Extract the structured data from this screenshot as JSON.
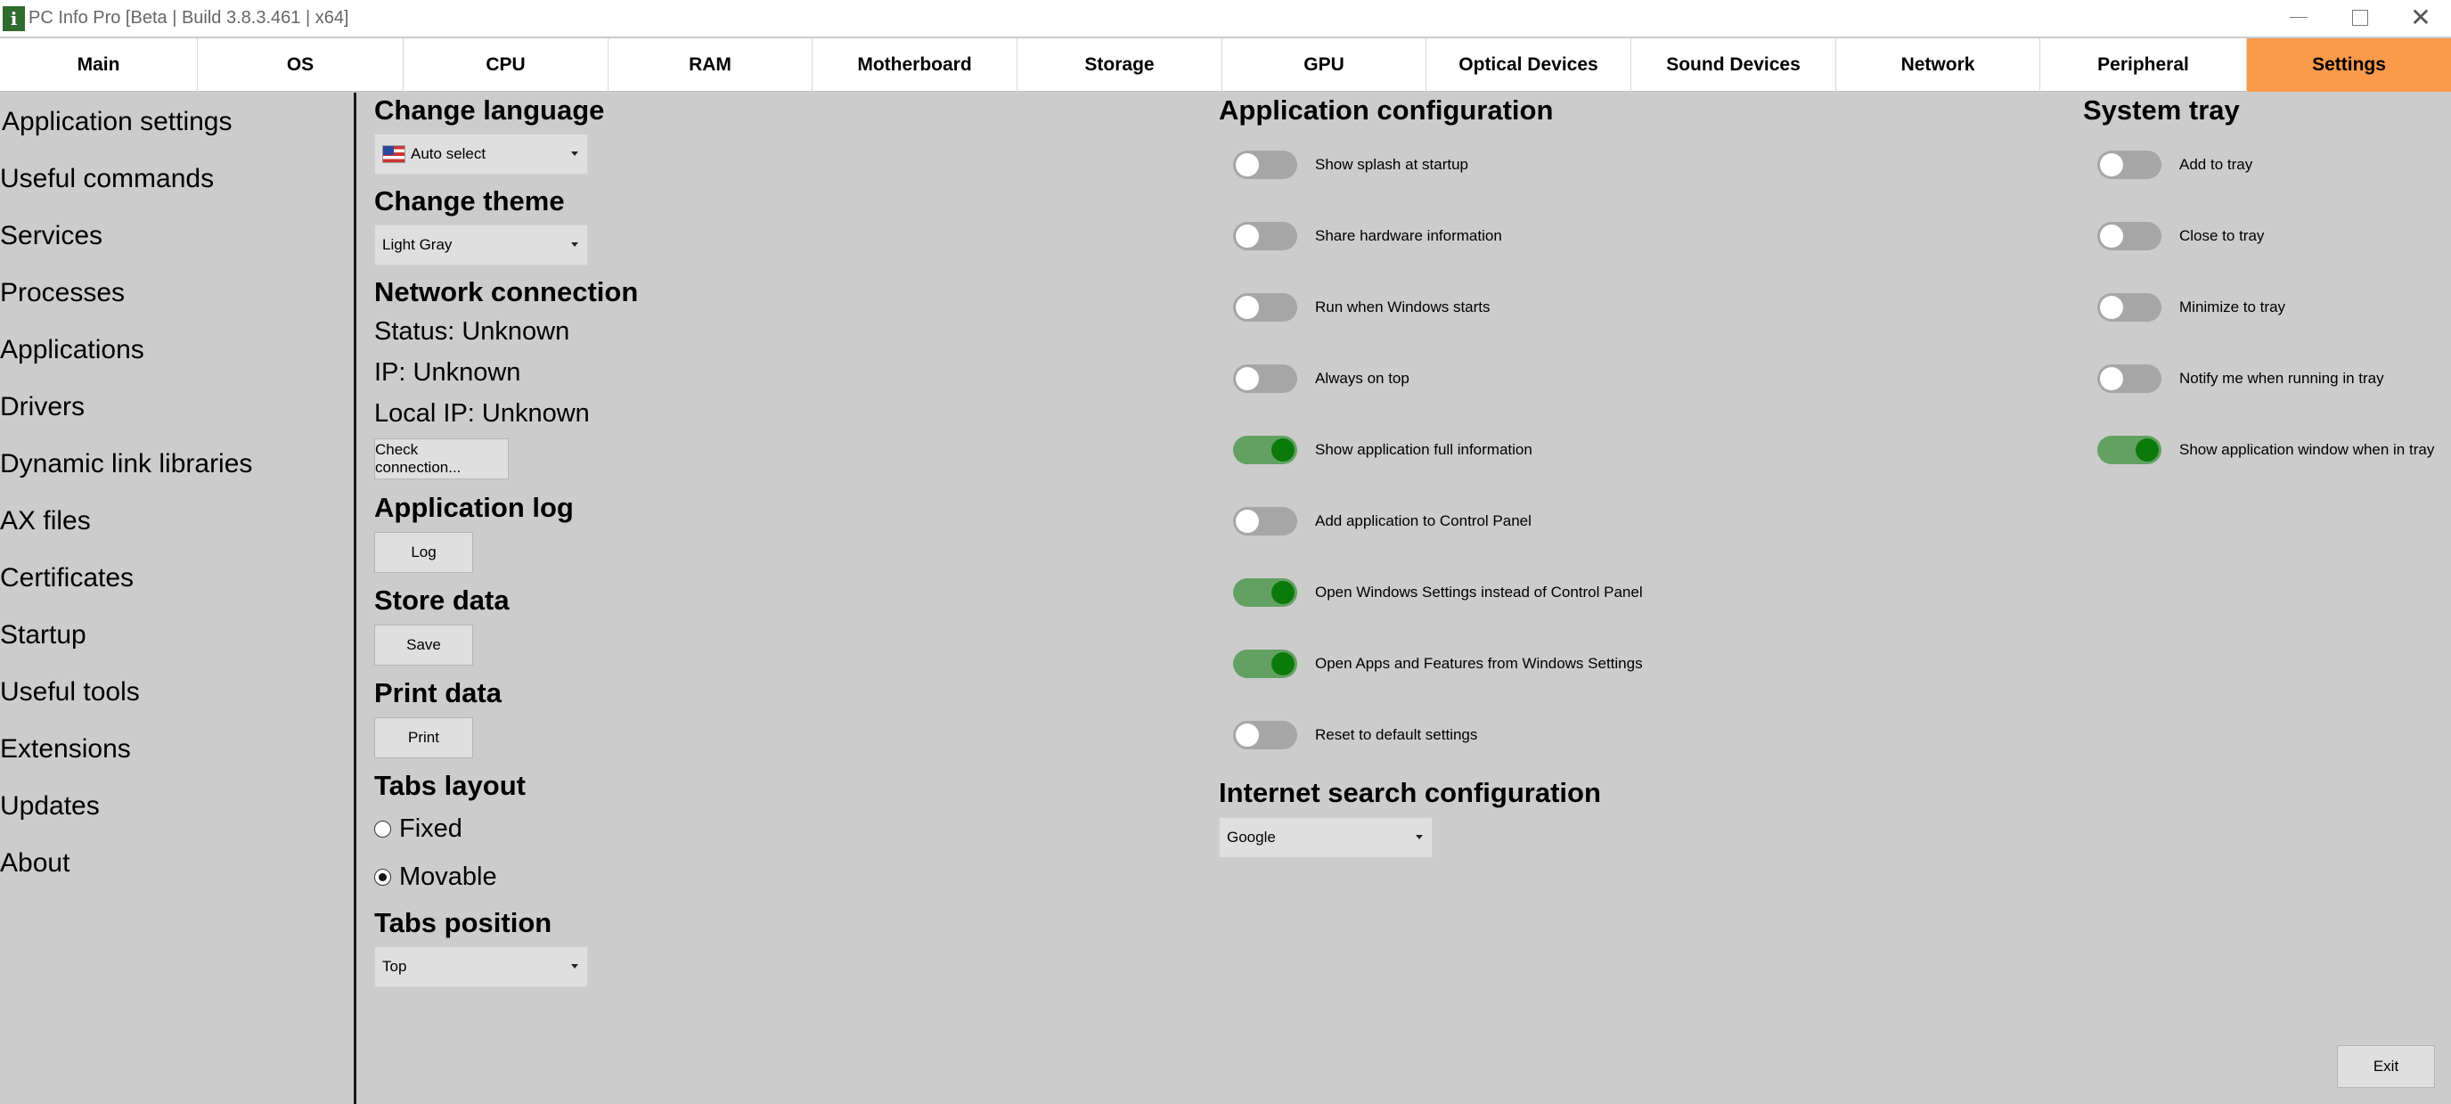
{
  "window": {
    "title": "PC Info Pro [Beta | Build 3.8.3.461 | x64]",
    "icon_letter": "i",
    "close_glyph": "✕"
  },
  "tabs": [
    {
      "label": "Main"
    },
    {
      "label": "OS"
    },
    {
      "label": "CPU"
    },
    {
      "label": "RAM"
    },
    {
      "label": "Motherboard"
    },
    {
      "label": "Storage"
    },
    {
      "label": "GPU"
    },
    {
      "label": "Optical Devices"
    },
    {
      "label": "Sound Devices"
    },
    {
      "label": "Network"
    },
    {
      "label": "Peripheral"
    },
    {
      "label": "Settings",
      "active": true
    }
  ],
  "accent_color": "#fb9a4b",
  "toggle_on_color": "#0b7a0b",
  "sidebar": {
    "items": [
      {
        "label": "Application settings"
      },
      {
        "label": "Useful commands"
      },
      {
        "label": "Services"
      },
      {
        "label": "Processes"
      },
      {
        "label": "Applications"
      },
      {
        "label": "Drivers"
      },
      {
        "label": "Dynamic link libraries"
      },
      {
        "label": "AX files"
      },
      {
        "label": "Certificates"
      },
      {
        "label": "Startup"
      },
      {
        "label": "Useful tools"
      },
      {
        "label": "Extensions"
      },
      {
        "label": "Updates"
      },
      {
        "label": "About"
      }
    ]
  },
  "language": {
    "heading": "Change language",
    "selected": "Auto select"
  },
  "theme": {
    "heading": "Change theme",
    "selected": "Light Gray"
  },
  "network": {
    "heading": "Network connection",
    "status": "Status: Unknown",
    "ip": "IP: Unknown",
    "local_ip": "Local IP: Unknown",
    "check_button": "Check connection..."
  },
  "app_log": {
    "heading": "Application log",
    "button": "Log"
  },
  "store": {
    "heading": "Store data",
    "button": "Save"
  },
  "print": {
    "heading": "Print data",
    "button": "Print"
  },
  "tabs_layout": {
    "heading": "Tabs layout",
    "options": [
      {
        "label": "Fixed",
        "selected": false
      },
      {
        "label": "Movable",
        "selected": true
      }
    ]
  },
  "tabs_position": {
    "heading": "Tabs position",
    "selected": "Top"
  },
  "app_config": {
    "heading": "Application configuration",
    "toggles": [
      {
        "label": "Show splash at startup",
        "on": false
      },
      {
        "label": "Share hardware information",
        "on": false
      },
      {
        "label": "Run when Windows starts",
        "on": false
      },
      {
        "label": "Always on top",
        "on": false
      },
      {
        "label": "Show application full information",
        "on": true
      },
      {
        "label": "Add application to Control Panel",
        "on": false
      },
      {
        "label": "Open Windows Settings instead of Control Panel",
        "on": true
      },
      {
        "label": "Open Apps and Features from Windows Settings",
        "on": true
      },
      {
        "label": "Reset to default settings",
        "on": false
      }
    ]
  },
  "search_config": {
    "heading": "Internet search configuration",
    "selected": "Google"
  },
  "system_tray": {
    "heading": "System tray",
    "toggles": [
      {
        "label": "Add to tray",
        "on": false
      },
      {
        "label": "Close to tray",
        "on": false
      },
      {
        "label": "Minimize to tray",
        "on": false
      },
      {
        "label": "Notify me when running in tray",
        "on": false
      },
      {
        "label": "Show application window when in tray",
        "on": true
      }
    ]
  },
  "exit_button": "Exit"
}
